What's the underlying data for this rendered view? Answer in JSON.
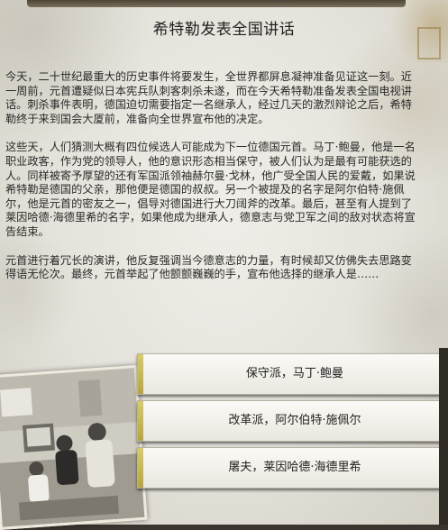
{
  "event": {
    "title": "希特勒发表全国讲话",
    "paragraphs": [
      "今天，二十世纪最重大的历史事件将要发生，全世界都屏息凝神准备见证这一刻。近一周前，元首遭疑似日本宪兵队刺客刺杀未遂，而在今天希特勒准备发表全国电视讲话。刺杀事件表明，德国迫切需要指定一名继承人，经过几天的激烈辩论之后，希特勒终于来到国会大厦前，准备向全世界宣布他的决定。",
      "这些天，人们猜测大概有四位候选人可能成为下一位德国元首。马丁·鲍曼，他是一名职业政客，作为党的领导人，他的意识形态相当保守，被人们认为是最有可能获选的人。同样被寄予厚望的还有军国派领袖赫尔曼·戈林，他广受全国人民的爱戴，如果说希特勒是德国的父亲，那他便是德国的叔叔。另一个被提及的名字是阿尔伯特·施佩尔，他是元首的密友之一，倡导对德国进行大刀阔斧的改革。最后，甚至有人提到了莱因哈德·海德里希的名字，如果他成为继承人，德意志与党卫军之间的敌对状态将宣告结束。",
      "元首进行着冗长的演讲，他反复强调当今德意志的力量，有时候却又仿佛失去思路变得语无伦次。最终，元首举起了他颤颤巍巍的手，宣布他选择的继承人是……"
    ]
  },
  "options": [
    {
      "label": "保守派，马丁·鲍曼"
    },
    {
      "label": "改革派，阿尔伯特·施佩尔"
    },
    {
      "label": "屠夫，莱因哈德·海德里希"
    }
  ],
  "colors": {
    "paper": "#e4e2da",
    "option_accent": "#c8b84c",
    "text": "#2a2a2a"
  }
}
